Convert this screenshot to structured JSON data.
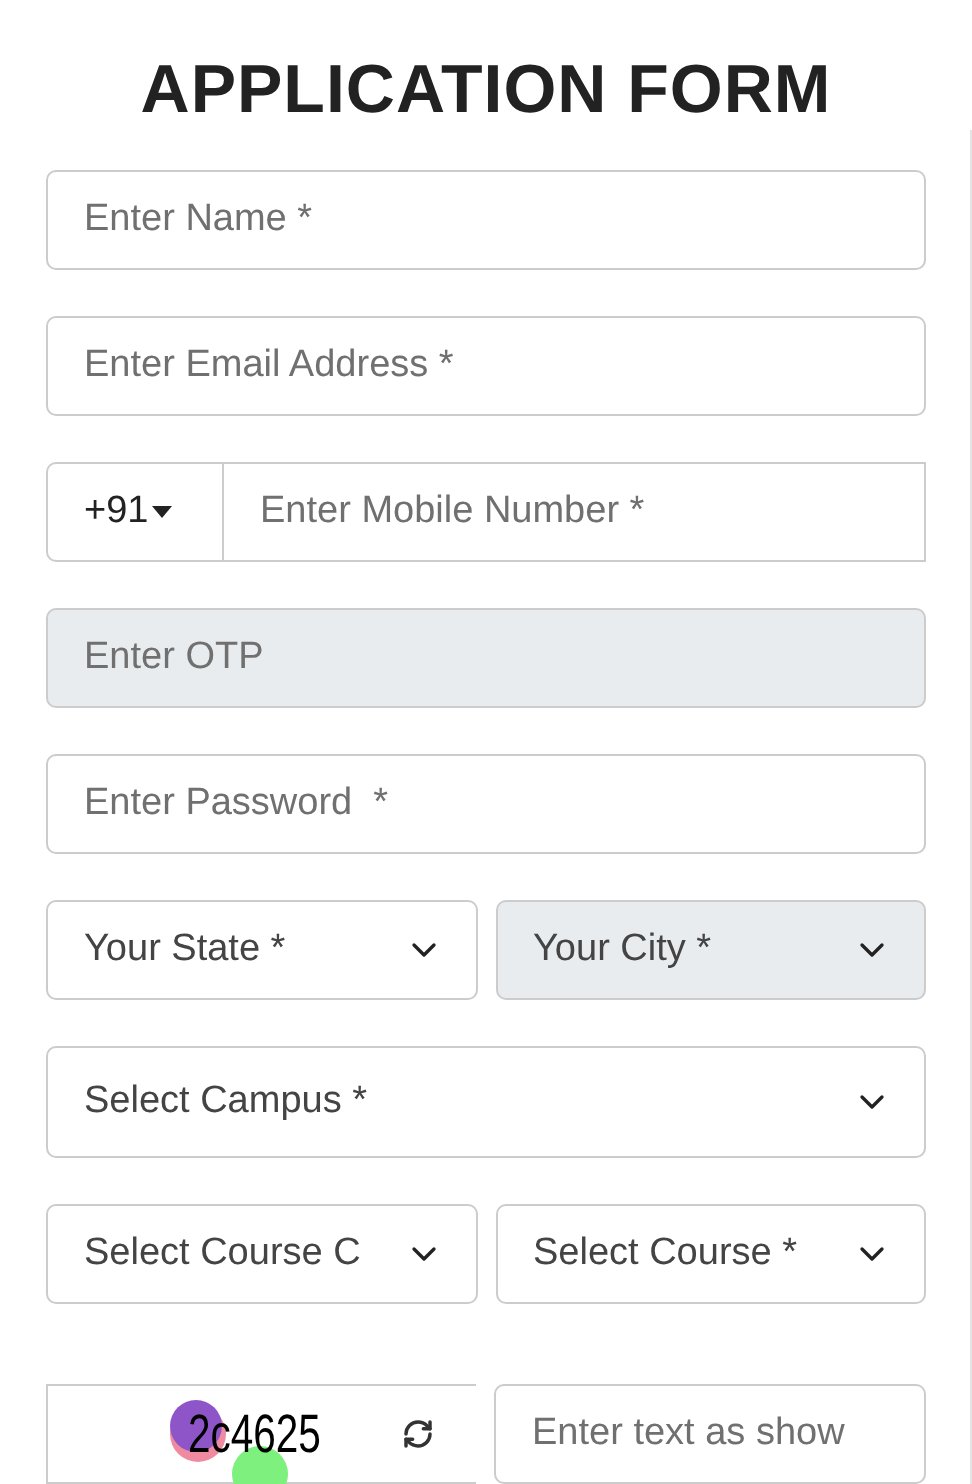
{
  "title": "APPLICATION FORM",
  "rows": [
    {
      "kind": "input",
      "placeholder": "Enter Name *",
      "disabled": false
    },
    {
      "kind": "input",
      "placeholder": "Enter Email Address *",
      "disabled": false
    },
    {
      "kind": "phone",
      "code": "+91",
      "placeholder": "Enter Mobile Number *",
      "disabled": false
    },
    {
      "kind": "input",
      "placeholder": "Enter OTP",
      "disabled": true
    },
    {
      "kind": "input",
      "placeholder": "Enter Password  *",
      "disabled": false
    },
    {
      "kind": "selects",
      "items": [
        {
          "label": "Your State *",
          "disabled": false
        },
        {
          "label": "Your City *",
          "disabled": true
        }
      ]
    },
    {
      "kind": "select",
      "label": "Select Campus *",
      "disabled": false
    },
    {
      "kind": "selects",
      "items": [
        {
          "label": "Select Course C",
          "disabled": false
        },
        {
          "label": "Select Course *",
          "disabled": false
        }
      ]
    },
    {
      "kind": "captcha",
      "code": "2c4625",
      "placeholder": "Enter text as show",
      "disabled": false
    }
  ]
}
